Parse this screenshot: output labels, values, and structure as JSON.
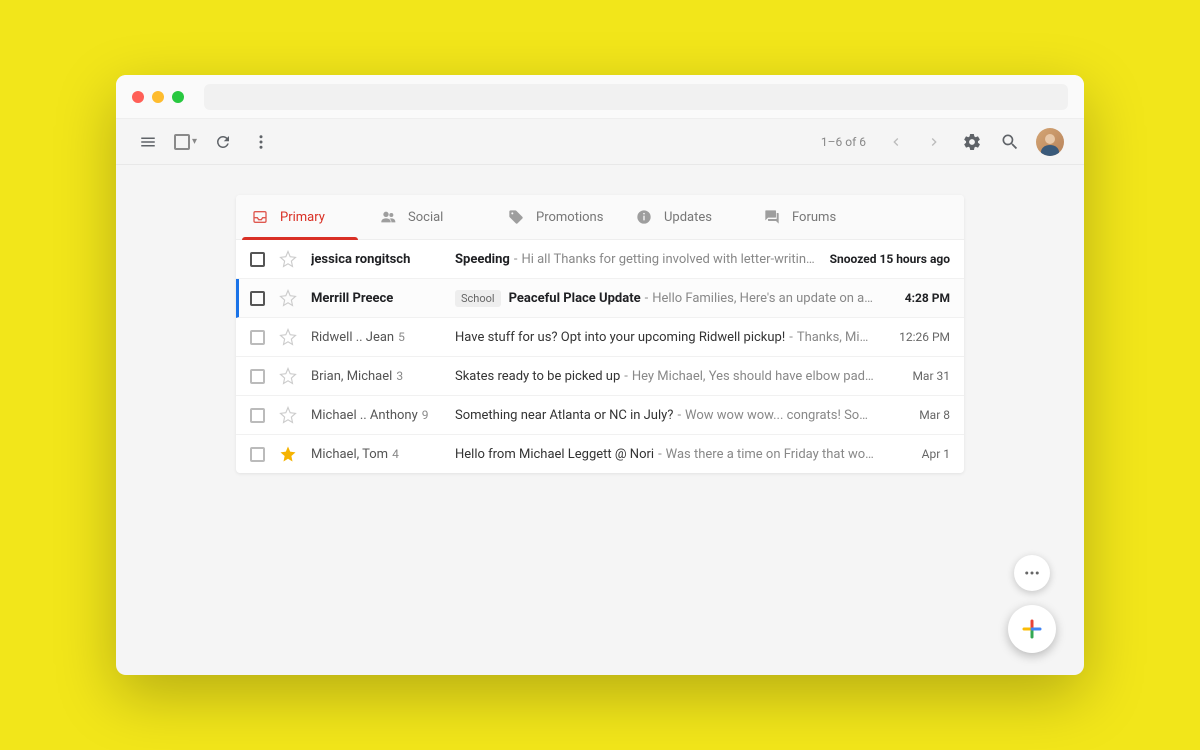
{
  "toolbar": {
    "count_text": "1–6 of 6"
  },
  "tabs": [
    {
      "label": "Primary",
      "icon": "inbox",
      "active": true
    },
    {
      "label": "Social",
      "icon": "people",
      "active": false
    },
    {
      "label": "Promotions",
      "icon": "tag",
      "active": false
    },
    {
      "label": "Updates",
      "icon": "info",
      "active": false
    },
    {
      "label": "Forums",
      "icon": "forum",
      "active": false
    }
  ],
  "emails": [
    {
      "sender": "jessica rongitsch",
      "count": null,
      "label": null,
      "subject": "Speeding",
      "preview": "Hi all Thanks for getting involved with letter-writing to see if it hel…",
      "date": "Snoozed 15 hours ago",
      "unread": true,
      "starred": false,
      "selected": false,
      "snoozed": true
    },
    {
      "sender": "Merrill Preece",
      "count": null,
      "label": "School",
      "subject": "Peaceful Place Update",
      "preview": "Hello Families, Here's an update on all we've been up to…",
      "date": "4:28 PM",
      "unread": true,
      "starred": false,
      "selected": true,
      "snoozed": false
    },
    {
      "sender": "Ridwell .. Jean",
      "count": "5",
      "label": null,
      "subject": "Have stuff for us? Opt into your upcoming Ridwell pickup!",
      "preview": "Thanks, Michael, I had forgot…",
      "date": "12:26 PM",
      "unread": false,
      "starred": false,
      "selected": false,
      "snoozed": false
    },
    {
      "sender": "Brian, Michael",
      "count": "3",
      "label": null,
      "subject": "Skates ready to be picked up",
      "preview": "Hey Michael, Yes should have elbow pads and knee pads, …",
      "date": "Mar 31",
      "unread": false,
      "starred": false,
      "selected": false,
      "snoozed": false
    },
    {
      "sender": "Michael .. Anthony",
      "count": "9",
      "label": null,
      "subject": "Something near Atlanta or NC in July?",
      "preview": "Wow wow wow... congrats! Sounds like you're pl…",
      "date": "Mar 8",
      "unread": false,
      "starred": false,
      "selected": false,
      "snoozed": false
    },
    {
      "sender": "Michael, Tom",
      "count": "4",
      "label": null,
      "subject": "Hello from Michael Leggett @ Nori",
      "preview": "Was there a time on Friday that works for you?",
      "date": "Apr 1",
      "unread": false,
      "starred": true,
      "selected": false,
      "snoozed": false
    }
  ]
}
